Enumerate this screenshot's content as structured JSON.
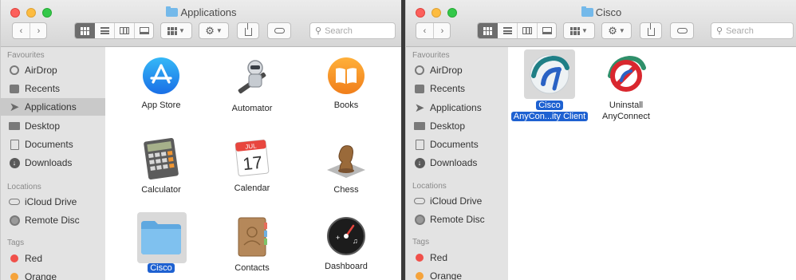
{
  "left_window": {
    "title": "Applications",
    "search_placeholder": "Search",
    "sidebar": {
      "favourites_header": "Favourites",
      "favourites": [
        {
          "label": "AirDrop",
          "icon": "airdrop-icon"
        },
        {
          "label": "Recents",
          "icon": "recents-icon"
        },
        {
          "label": "Applications",
          "icon": "applications-icon",
          "selected": true
        },
        {
          "label": "Desktop",
          "icon": "desktop-icon"
        },
        {
          "label": "Documents",
          "icon": "documents-icon"
        },
        {
          "label": "Downloads",
          "icon": "downloads-icon"
        }
      ],
      "locations_header": "Locations",
      "locations": [
        {
          "label": "iCloud Drive",
          "icon": "icloud-icon"
        },
        {
          "label": "Remote Disc",
          "icon": "remote-disc-icon"
        }
      ],
      "tags_header": "Tags",
      "tags": [
        {
          "label": "Red",
          "color": "#f0504a"
        },
        {
          "label": "Orange",
          "color": "#f5a33b"
        }
      ]
    },
    "files": [
      {
        "label": "App Store",
        "icon": "app-store-icon"
      },
      {
        "label": "Automator",
        "icon": "automator-icon"
      },
      {
        "label": "Books",
        "icon": "books-icon"
      },
      {
        "label": "Calculator",
        "icon": "calculator-icon"
      },
      {
        "label": "Calendar",
        "icon": "calendar-icon",
        "month": "JUL",
        "day": "17"
      },
      {
        "label": "Chess",
        "icon": "chess-icon"
      },
      {
        "label": "Cisco",
        "icon": "folder-icon",
        "selected": true
      },
      {
        "label": "Contacts",
        "icon": "contacts-icon"
      },
      {
        "label": "Dashboard",
        "icon": "dashboard-icon"
      }
    ]
  },
  "right_window": {
    "title": "Cisco",
    "search_placeholder": "Search",
    "sidebar": {
      "favourites_header": "Favourites",
      "favourites": [
        {
          "label": "AirDrop",
          "icon": "airdrop-icon"
        },
        {
          "label": "Recents",
          "icon": "recents-icon"
        },
        {
          "label": "Applications",
          "icon": "applications-icon"
        },
        {
          "label": "Desktop",
          "icon": "desktop-icon"
        },
        {
          "label": "Documents",
          "icon": "documents-icon"
        },
        {
          "label": "Downloads",
          "icon": "downloads-icon"
        }
      ],
      "locations_header": "Locations",
      "locations": [
        {
          "label": "iCloud Drive",
          "icon": "icloud-icon"
        },
        {
          "label": "Remote Disc",
          "icon": "remote-disc-icon"
        }
      ],
      "tags_header": "Tags",
      "tags": [
        {
          "label": "Red",
          "color": "#f0504a"
        },
        {
          "label": "Orange",
          "color": "#f5a33b"
        }
      ]
    },
    "files": [
      {
        "label_line1": "Cisco",
        "label_line2": "AnyCon...ity Client",
        "icon": "cisco-anyconnect-icon",
        "selected": true
      },
      {
        "label_line1": "Uninstall",
        "label_line2": "AnyConnect",
        "icon": "uninstall-anyconnect-icon"
      }
    ]
  },
  "colors": {
    "selection_blue": "#1e61d1",
    "sidebar_bg": "#e3e3e3",
    "folder_blue": "#74b9ea"
  }
}
